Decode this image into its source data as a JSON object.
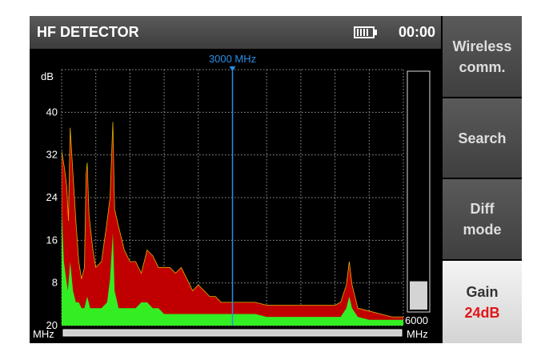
{
  "header": {
    "title": "HF DETECTOR",
    "time": "00:00"
  },
  "sidebar": {
    "buttons": [
      {
        "line1": "Wireless",
        "line2": "comm."
      },
      {
        "line1": "Search"
      },
      {
        "line1": "Diff",
        "line2": "mode"
      },
      {
        "line1": "Gain",
        "value": "24dB"
      }
    ]
  },
  "chart_data": {
    "type": "area",
    "marker_label": "3000 MHz",
    "marker_x": 3000,
    "ylabel": "dB",
    "y_ticks": [
      "40",
      "32",
      "24",
      "16",
      "8",
      "20"
    ],
    "ylim": [
      0,
      44
    ],
    "xlim": [
      0,
      6000
    ],
    "x_left_label": "MHz",
    "x_right_top": "6000",
    "x_right_bottom": "MHz",
    "level_meter": 0.12,
    "colors": {
      "outer": "#c00000",
      "inner": "#33ee22",
      "marker": "#2a8ee6"
    },
    "series": [
      {
        "values": [
          [
            0,
            30
          ],
          [
            50,
            27
          ],
          [
            90,
            24
          ],
          [
            120,
            18
          ],
          [
            150,
            34
          ],
          [
            200,
            26
          ],
          [
            250,
            18
          ],
          [
            300,
            11
          ],
          [
            350,
            8
          ],
          [
            400,
            10
          ],
          [
            430,
            26
          ],
          [
            450,
            28
          ],
          [
            480,
            19
          ],
          [
            550,
            13
          ],
          [
            600,
            10
          ],
          [
            700,
            11
          ],
          [
            800,
            18
          ],
          [
            850,
            22
          ],
          [
            900,
            35
          ],
          [
            930,
            20
          ],
          [
            1000,
            17
          ],
          [
            1100,
            13
          ],
          [
            1200,
            11
          ],
          [
            1300,
            11
          ],
          [
            1400,
            9
          ],
          [
            1500,
            13
          ],
          [
            1600,
            12
          ],
          [
            1700,
            10
          ],
          [
            1800,
            10
          ],
          [
            1900,
            10
          ],
          [
            2000,
            9
          ],
          [
            2100,
            10
          ],
          [
            2200,
            8
          ],
          [
            2300,
            6
          ],
          [
            2400,
            7
          ],
          [
            2500,
            6
          ],
          [
            2600,
            5
          ],
          [
            2700,
            5
          ],
          [
            2800,
            4
          ],
          [
            2900,
            4
          ],
          [
            3000,
            4
          ],
          [
            3200,
            4
          ],
          [
            3400,
            4
          ],
          [
            3600,
            3.5
          ],
          [
            3800,
            3.5
          ],
          [
            4000,
            3.5
          ],
          [
            4200,
            3.5
          ],
          [
            4400,
            3.5
          ],
          [
            4600,
            3.5
          ],
          [
            4800,
            3.5
          ],
          [
            4900,
            4
          ],
          [
            5000,
            7
          ],
          [
            5050,
            11
          ],
          [
            5100,
            7
          ],
          [
            5200,
            3
          ],
          [
            5400,
            2.5
          ],
          [
            5600,
            2
          ],
          [
            5800,
            1.5
          ],
          [
            6000,
            1.5
          ]
        ]
      },
      {
        "values": [
          [
            0,
            20
          ],
          [
            40,
            11
          ],
          [
            80,
            8
          ],
          [
            110,
            6
          ],
          [
            150,
            11
          ],
          [
            200,
            6
          ],
          [
            250,
            4
          ],
          [
            300,
            4
          ],
          [
            350,
            3
          ],
          [
            400,
            3
          ],
          [
            450,
            5
          ],
          [
            500,
            3
          ],
          [
            550,
            3
          ],
          [
            600,
            3
          ],
          [
            700,
            3
          ],
          [
            800,
            4
          ],
          [
            850,
            8
          ],
          [
            900,
            16
          ],
          [
            930,
            6
          ],
          [
            1000,
            3
          ],
          [
            1100,
            3
          ],
          [
            1200,
            3
          ],
          [
            1300,
            3
          ],
          [
            1400,
            4
          ],
          [
            1500,
            4
          ],
          [
            1600,
            3
          ],
          [
            1700,
            3
          ],
          [
            1800,
            2
          ],
          [
            1900,
            2
          ],
          [
            2000,
            2
          ],
          [
            2200,
            2
          ],
          [
            2400,
            2
          ],
          [
            2600,
            2
          ],
          [
            2800,
            2
          ],
          [
            3000,
            2
          ],
          [
            3200,
            2
          ],
          [
            3400,
            2
          ],
          [
            3600,
            1.5
          ],
          [
            3800,
            1.5
          ],
          [
            4000,
            1.5
          ],
          [
            4200,
            1.5
          ],
          [
            4400,
            1.5
          ],
          [
            4600,
            1.5
          ],
          [
            4800,
            1.5
          ],
          [
            4900,
            1.5
          ],
          [
            5000,
            3
          ],
          [
            5050,
            5
          ],
          [
            5100,
            3
          ],
          [
            5200,
            1.5
          ],
          [
            5400,
            1
          ],
          [
            5600,
            1
          ],
          [
            5800,
            1
          ],
          [
            6000,
            1
          ]
        ]
      }
    ]
  }
}
